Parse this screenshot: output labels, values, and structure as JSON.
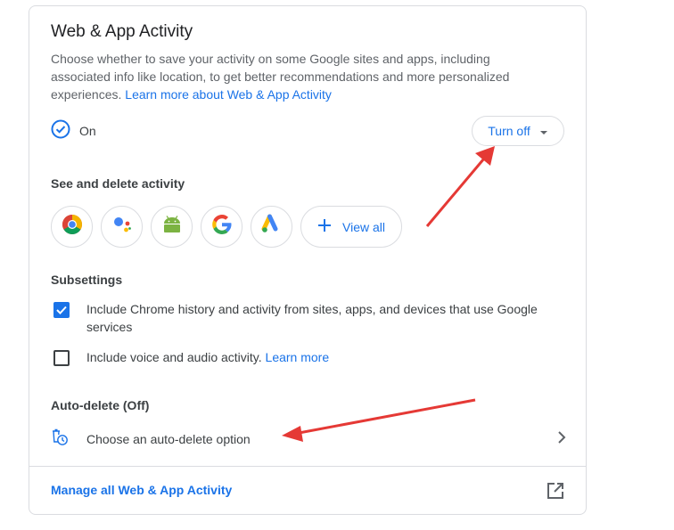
{
  "header": {
    "title": "Web & App Activity",
    "description": "Choose whether to save your activity on some Google sites and apps, including associated info like location, to get better recommendations and more personalized experiences.",
    "learn_more": "Learn more about Web & App Activity"
  },
  "status": {
    "text": "On",
    "button_label": "Turn off"
  },
  "activity": {
    "title": "See and delete activity",
    "apps": [
      {
        "icon": "chrome-icon"
      },
      {
        "icon": "google-assistant-icon"
      },
      {
        "icon": "android-icon"
      },
      {
        "icon": "google-icon"
      },
      {
        "icon": "google-ads-icon"
      }
    ],
    "view_all": "View all"
  },
  "subsettings": {
    "title": "Subsettings",
    "items": [
      {
        "label": "Include Chrome history and activity from sites, apps, and devices that use Google services",
        "checked": true
      },
      {
        "label": "Include voice and audio activity.",
        "link": "Learn more",
        "checked": false
      }
    ]
  },
  "autodelete": {
    "title": "Auto-delete (Off)",
    "option": "Choose an auto-delete option"
  },
  "footer": {
    "manage": "Manage all Web & App Activity"
  },
  "colors": {
    "accent": "#1a73e8",
    "annotation_arrow": "#e53935"
  }
}
